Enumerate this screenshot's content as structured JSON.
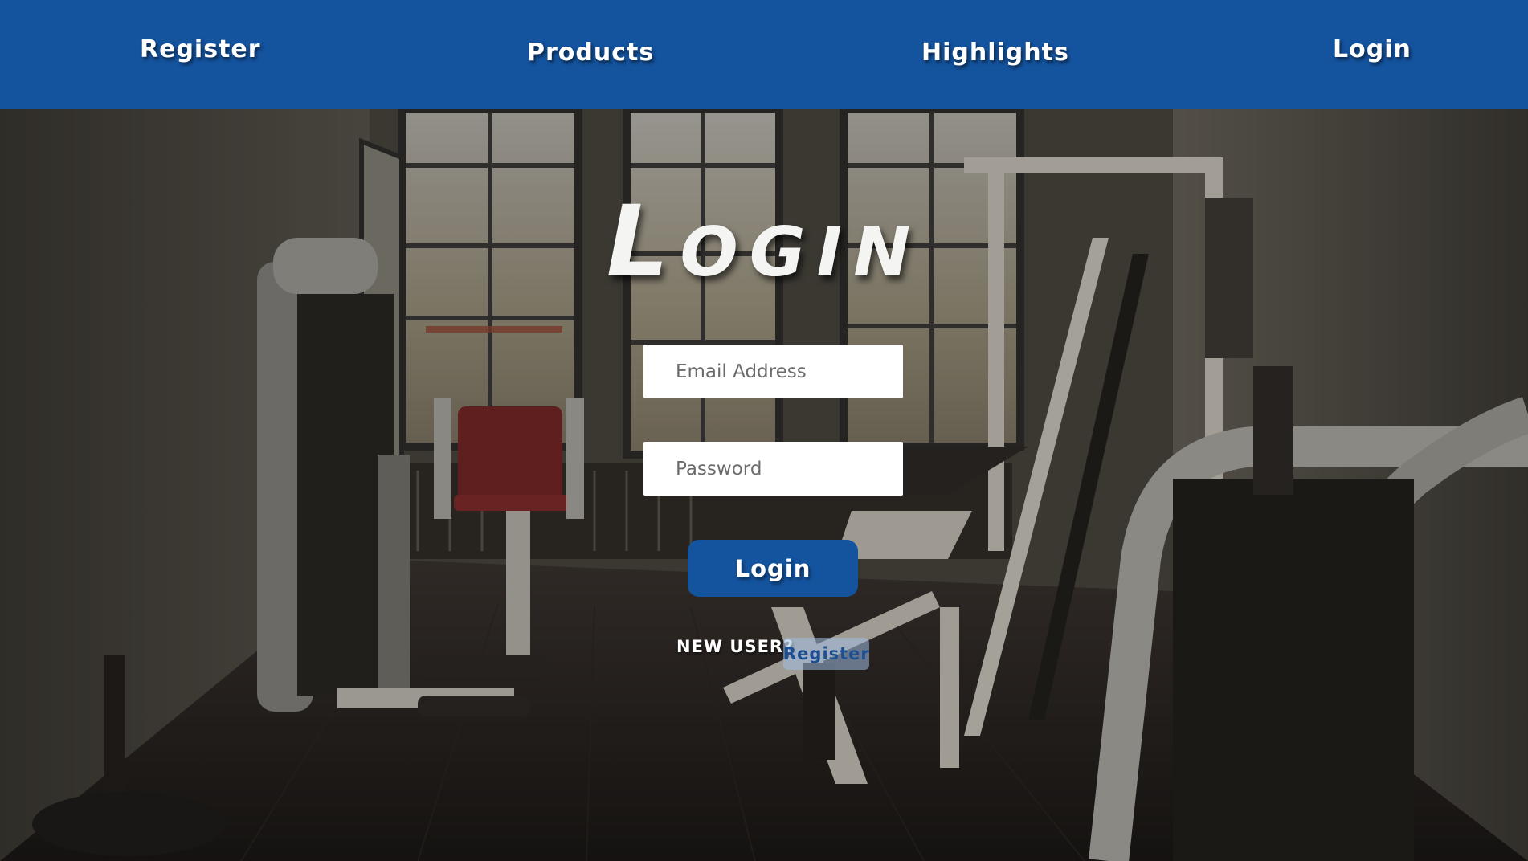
{
  "nav": {
    "register": "Register",
    "products": "Products",
    "highlights": "Highlights",
    "login": "Login"
  },
  "form": {
    "heading": "Login",
    "email_placeholder": "Email Address",
    "password_placeholder": "Password",
    "submit_label": "Login",
    "new_user_text": "NEW USER?",
    "register_link": "Register"
  },
  "colors": {
    "brand_blue": "#14539e",
    "register_link_bg": "#a0bee1",
    "text_light": "#ffffff"
  },
  "background": {
    "scene": "gym equipment room with windows"
  }
}
